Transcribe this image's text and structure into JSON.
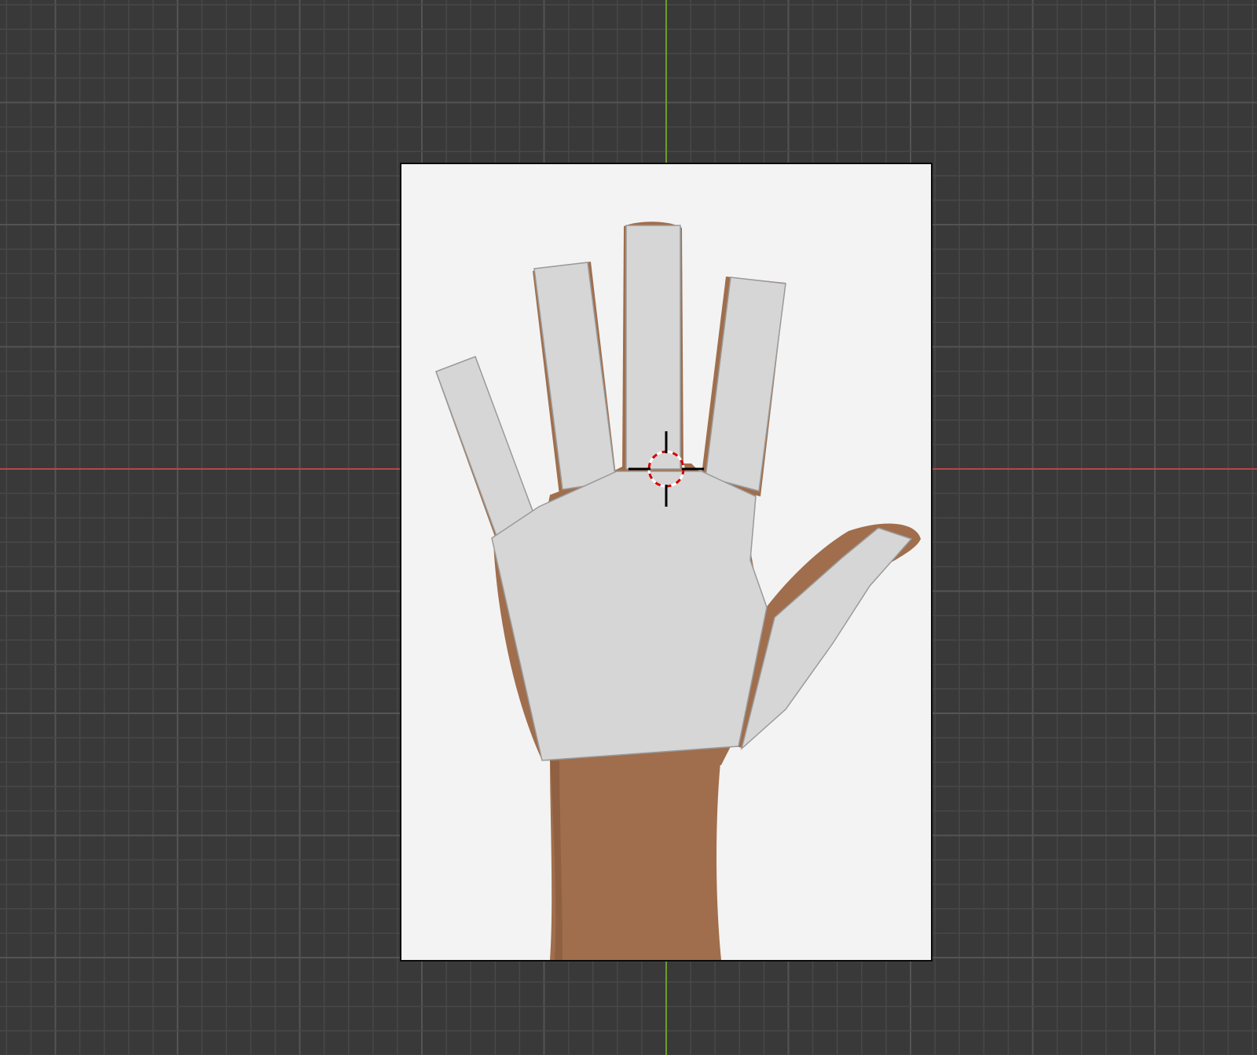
{
  "viewport": {
    "background_color": "#393939",
    "grid_minor_color": "#484848",
    "grid_major_color": "#545454",
    "x_axis_color": "#b5464a",
    "y_axis_color": "#6e9a2f"
  },
  "reference_image": {
    "subject": "hand-photo",
    "background_color": "#f3f3f3",
    "skin_color": "#a06e4c",
    "skin_shadow_color": "#7e5236"
  },
  "mesh": {
    "fill_color": "#d6d6d6",
    "edge_color": "#9a9a9a",
    "parts": [
      "pinky",
      "ring-finger",
      "middle-finger",
      "index-finger",
      "palm",
      "thumb"
    ]
  },
  "cursor_3d": {
    "ring_color_a": "#ffffff",
    "ring_color_b": "#d40000",
    "crosshair_color": "#000000"
  }
}
